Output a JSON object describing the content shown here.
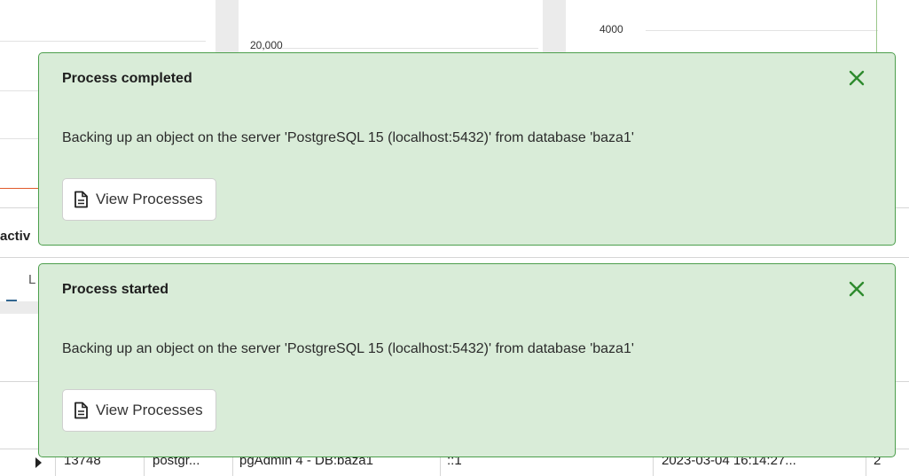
{
  "background": {
    "chart_ticks": [
      "20,000",
      "4000"
    ],
    "section_fragment": "activ",
    "tab_fragment": "L",
    "row": {
      "pid": "13748",
      "user": "postgr...",
      "application": "pgAdmin 4 - DB:baza1",
      "client": "::1",
      "start_time": "2023-03-04 16:14:27...",
      "extra": "2"
    }
  },
  "toasts": [
    {
      "title": "Process completed",
      "message": "Backing up an object on the server 'PostgreSQL 15 (localhost:5432)' from database 'baza1'",
      "button_label": "View Processes"
    },
    {
      "title": "Process started",
      "message": "Backing up an object on the server 'PostgreSQL 15 (localhost:5432)' from database 'baza1'",
      "button_label": "View Processes"
    }
  ],
  "colors": {
    "toast_bg": "#d9ecd8",
    "toast_border": "#4c9e4c",
    "close_icon": "#2e8b2e",
    "chart_line": "#e05a2b"
  },
  "icons": {
    "close": "close-icon",
    "button": "document-icon"
  }
}
